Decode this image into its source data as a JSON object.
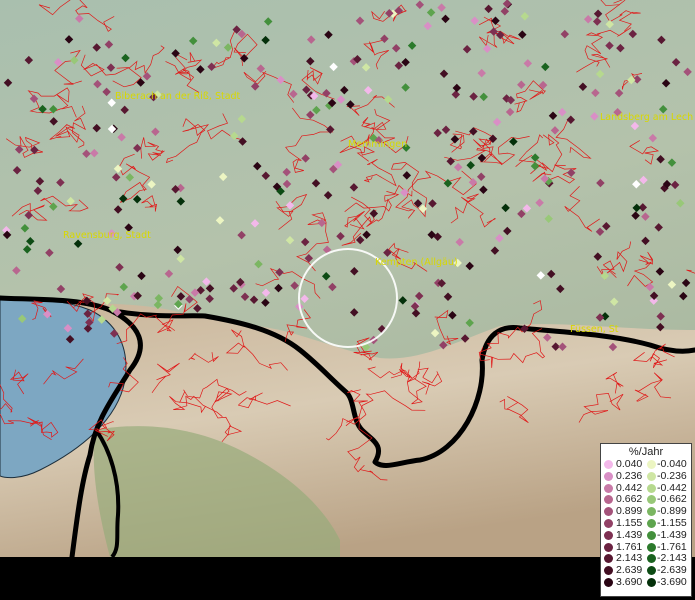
{
  "cities": [
    {
      "name": "Biberach an der Riß, Stadt"
    },
    {
      "name": "Memmingen"
    },
    {
      "name": "Landsberg am Lech"
    },
    {
      "name": "Ravensburg, Stadt"
    },
    {
      "name": "Kempten (Allgäu)"
    },
    {
      "name": "Füssen, St"
    }
  ],
  "legend": {
    "title": "%/Jahr",
    "positive": [
      {
        "label": "0.040",
        "color": "#f3b8ea"
      },
      {
        "label": "0.236",
        "color": "#d98fc6"
      },
      {
        "label": "0.442",
        "color": "#c97aa8"
      },
      {
        "label": "0.662",
        "color": "#b8668f"
      },
      {
        "label": "0.899",
        "color": "#a4527a"
      },
      {
        "label": "1.155",
        "color": "#924166"
      },
      {
        "label": "1.439",
        "color": "#7e3052"
      },
      {
        "label": "1.761",
        "color": "#6b2342"
      },
      {
        "label": "2.143",
        "color": "#571831"
      },
      {
        "label": "2.639",
        "color": "#430f23"
      },
      {
        "label": "3.690",
        "color": "#2a0514"
      }
    ],
    "negative": [
      {
        "label": "-0.040",
        "color": "#ecf5c2"
      },
      {
        "label": "-0.236",
        "color": "#cfe6a4"
      },
      {
        "label": "-0.442",
        "color": "#b6d98e"
      },
      {
        "label": "-0.662",
        "color": "#98c878"
      },
      {
        "label": "-0.899",
        "color": "#7bb662"
      },
      {
        "label": "-1.155",
        "color": "#5ea44e"
      },
      {
        "label": "-1.439",
        "color": "#43903c"
      },
      {
        "label": "-1.761",
        "color": "#2c7a2c"
      },
      {
        "label": "-2.143",
        "color": "#1a631f"
      },
      {
        "label": "-2.639",
        "color": "#0d4b14"
      },
      {
        "label": "-3.690",
        "color": "#04300a"
      }
    ]
  }
}
